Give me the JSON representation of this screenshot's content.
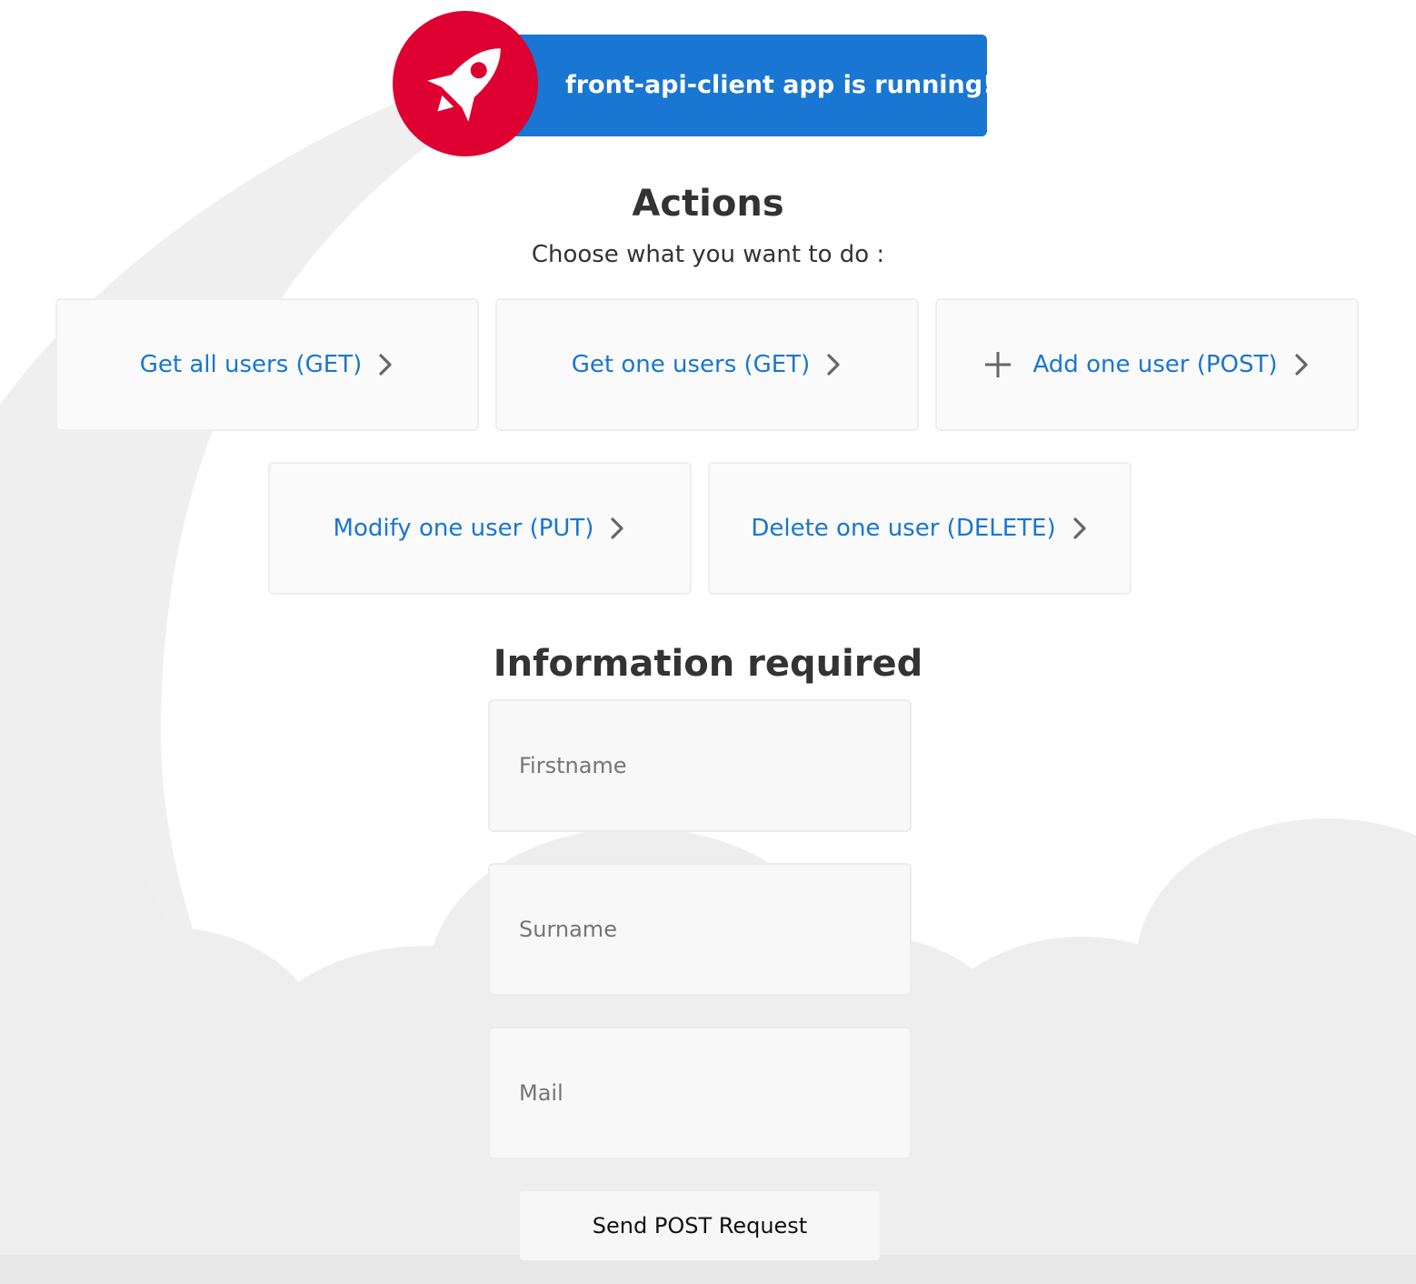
{
  "banner": {
    "text": "front-api-client app is running!",
    "icon": "rocket-icon"
  },
  "actions": {
    "title": "Actions",
    "subtitle": "Choose what you want to do :",
    "items": [
      {
        "label": "Get all users (GET)",
        "icon": "chevron-right-icon"
      },
      {
        "label": "Get one users (GET)",
        "icon": "chevron-right-icon"
      },
      {
        "label": "Add one user (POST)",
        "icon": "chevron-right-icon",
        "leading_icon": "plus-icon"
      },
      {
        "label": "Modify one user (PUT)",
        "icon": "chevron-right-icon"
      },
      {
        "label": "Delete one user (DELETE)",
        "icon": "chevron-right-icon"
      }
    ]
  },
  "form": {
    "title": "Information required",
    "firstname": {
      "placeholder": "Firstname",
      "value": ""
    },
    "surname": {
      "placeholder": "Surname",
      "value": ""
    },
    "mail": {
      "placeholder": "Mail",
      "value": ""
    },
    "submit_label": "Send POST Request"
  },
  "colors": {
    "accent": "#1976d2",
    "brand": "#dd0031",
    "card_bg": "#fafafa",
    "text": "#333333"
  }
}
